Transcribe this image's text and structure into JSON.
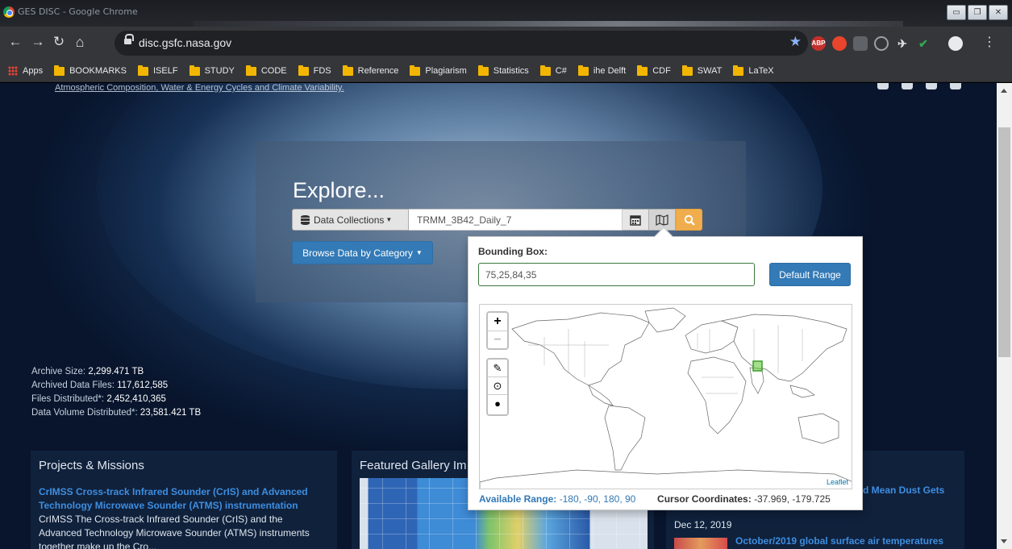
{
  "window": {
    "title": "GES DISC - Google Chrome"
  },
  "browser": {
    "url": "disc.gsfc.nasa.gov",
    "bookmarks": [
      "Apps",
      "BOOKMARKS",
      "ISELF",
      "STUDY",
      "CODE",
      "FDS",
      "Reference",
      "Plagiarism",
      "Statistics",
      "C#",
      "ihe Delft",
      "CDF",
      "SWAT",
      "LaTeX"
    ],
    "extensions": [
      "ABP"
    ]
  },
  "page": {
    "top_links": "Atmospheric Composition, Water & Energy Cycles and Climate Variability.",
    "explore_title": "Explore...",
    "search": {
      "collections_label": "Data Collections",
      "query": "TRMM_3B42_Daily_7"
    },
    "browse_button": "Browse Data by Category",
    "stats": [
      {
        "label": "Archive Size: ",
        "value": "2,299.471 TB"
      },
      {
        "label": "Archived Data Files: ",
        "value": "117,612,585"
      },
      {
        "label": "Files Distributed*: ",
        "value": "2,452,410,365"
      },
      {
        "label": "Data Volume Distributed*: ",
        "value": "23,581.421 TB"
      }
    ],
    "projects": {
      "title": "Projects & Missions",
      "link": "CrIMSS Cross-track Infrared Sounder (CrIS) and Advanced Technology Microwave Sounder (ATMS) instrumentation",
      "desc": "CrIMSS  The Cross-track Infrared Sounder (CrIS) and the Advanced Technology Microwave Sounder (ATMS) instruments together make up the Cro..."
    },
    "gallery": {
      "title": "Featured Gallery Im"
    },
    "news": {
      "link1": "d Mean Dust Gets",
      "date": "Dec 12, 2019",
      "link2": "October/2019 global surface air temperatures"
    }
  },
  "popover": {
    "bbox_label": "Bounding Box:",
    "bbox_value": "75,25,84,35",
    "default_button": "Default Range",
    "zoom_in": "+",
    "zoom_out": "−",
    "attribution": "Leaflet",
    "available_range_label": "Available Range:",
    "available_range_value": "-180, -90, 180, 90",
    "cursor_label": "Cursor Coordinates:",
    "cursor_value": "-37.969, -179.725"
  }
}
